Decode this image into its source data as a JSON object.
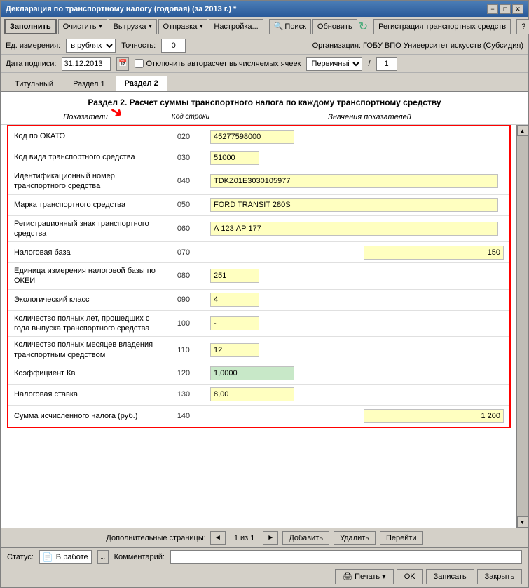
{
  "window": {
    "title": "Декларация по транспортному налогу (годовая) (за 2013 г.) *",
    "min_btn": "−",
    "max_btn": "□",
    "close_btn": "✕"
  },
  "toolbar": {
    "fill_btn": "Заполнить",
    "clear_btn": "Очистить",
    "clear_arrow": "▾",
    "export_btn": "Выгрузка",
    "export_arrow": "▾",
    "send_btn": "Отправка",
    "send_arrow": "▾",
    "settings_btn": "Настройка...",
    "search_icon": "🔍",
    "search_btn": "Поиск",
    "refresh_btn": "Обновить",
    "register_btn": "Регистрация транспортных средств",
    "help_btn": "?"
  },
  "options": {
    "unit_label": "Ед. измерения:",
    "unit_value": "в рублях",
    "precision_label": "Точность:",
    "precision_value": "0",
    "org_label": "Организация:",
    "org_value": "ГОБУ ВПО Университет искусств (Субсидия)"
  },
  "date_bar": {
    "date_label": "Дата подписи:",
    "date_value": "31.12.2013",
    "autocalc_label": "Отключить авторасчет вычисляемых ячеек",
    "primary_label": "Первичный",
    "slash": "/",
    "num_value": "1"
  },
  "tabs": [
    {
      "id": "titulny",
      "label": "Титульный"
    },
    {
      "id": "razdel1",
      "label": "Раздел 1"
    },
    {
      "id": "razdel2",
      "label": "Раздел 2",
      "active": true
    }
  ],
  "section": {
    "title": "Раздел 2. Расчет суммы транспортного налога по каждому транспортному средству",
    "col_headers": {
      "indicators": "Показатели",
      "code": "Код строки",
      "values": "Значения показателей"
    }
  },
  "rows": [
    {
      "label": "Код по ОКАТО",
      "code": "020",
      "value": "45277598000",
      "field_type": "medium",
      "align": "left"
    },
    {
      "label": "Код вида транспортного средства",
      "code": "030",
      "value": "51000",
      "field_type": "small",
      "align": "left"
    },
    {
      "label": "Идентификационный номер транспортного средства",
      "code": "040",
      "value": "TDKZ01E3030105977",
      "field_type": "wide",
      "align": "left"
    },
    {
      "label": "Марка транспортного средства",
      "code": "050",
      "value": "FORD TRANSIT 280S",
      "field_type": "wide",
      "align": "left"
    },
    {
      "label": "Регистрационный знак транспортного средства",
      "code": "060",
      "value": "А 123 АР 177",
      "field_type": "wide",
      "align": "left"
    },
    {
      "label": "Налоговая база",
      "code": "070",
      "value": "150",
      "field_type": "right-align-wide",
      "align": "right"
    },
    {
      "label": "Единица измерения налоговой базы по ОКЕИ",
      "code": "080",
      "value": "251",
      "field_type": "small",
      "align": "left"
    },
    {
      "label": "Экологический класс",
      "code": "090",
      "value": "4",
      "field_type": "small",
      "align": "left"
    },
    {
      "label": "Количество полных лет, прошедших с года выпуска транспортного средства",
      "code": "100",
      "value": "-",
      "field_type": "small",
      "align": "left"
    },
    {
      "label": "Количество полных месяцев владения транспортным средством",
      "code": "110",
      "value": "12",
      "field_type": "small",
      "align": "left"
    },
    {
      "label": "Коэффициент Кв",
      "code": "120",
      "value": "1,0000",
      "field_type": "medium-green",
      "align": "left"
    },
    {
      "label": "Налоговая ставка",
      "code": "130",
      "value": "8,00",
      "field_type": "medium",
      "align": "left"
    },
    {
      "label": "Сумма исчисленного налога (руб.)",
      "code": "140",
      "value": "1 200",
      "field_type": "right-align-wide",
      "align": "right"
    }
  ],
  "bottom_nav": {
    "pages_label": "Дополнительные страницы:",
    "prev_btn": "◄",
    "page_info": "1 из 1",
    "next_btn": "►",
    "add_btn": "Добавить",
    "delete_btn": "Удалить",
    "go_btn": "Перейти"
  },
  "status_bar": {
    "status_label": "Статус:",
    "status_icon": "📄",
    "status_value": "В работе",
    "status_dots": "...",
    "comment_label": "Комментарий:"
  },
  "bottom_buttons": {
    "print_icon": "🖨",
    "print_btn": "Печать ▾",
    "ok_btn": "OK",
    "save_btn": "Записать",
    "close_btn": "Закрыть"
  }
}
